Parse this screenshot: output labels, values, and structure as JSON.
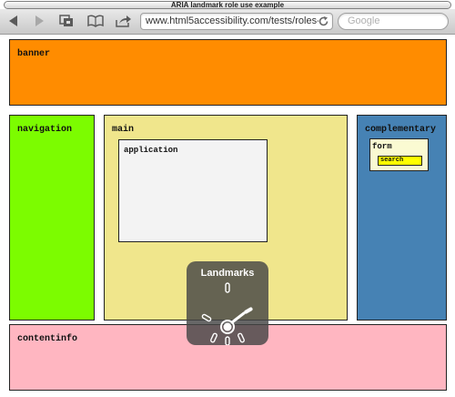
{
  "window": {
    "title": "ARIA landmark role use example"
  },
  "toolbar": {
    "back_icon": "back-arrow-icon",
    "forward_icon": "forward-arrow-icon",
    "tabs_icon": "tabs-icon",
    "bookmarks_icon": "open-book-icon",
    "share_icon": "share-icon",
    "url": "www.html5accessibility.com/tests/roles-la…",
    "reload_icon": "reload-icon",
    "search_placeholder": "Google"
  },
  "landmarks": {
    "banner": {
      "label": "banner",
      "color": "#ff8c00"
    },
    "navigation": {
      "label": "navigation",
      "color": "#7cfc00"
    },
    "main": {
      "label": "main",
      "color": "#f0e68c"
    },
    "application": {
      "label": "application",
      "color": "#f3f3f3"
    },
    "complementary": {
      "label": "complementary",
      "color": "#4682b4"
    },
    "form": {
      "label": "form",
      "color": "#fafad2"
    },
    "search": {
      "label": "search",
      "color": "#ffff00"
    },
    "contentinfo": {
      "label": "contentinfo",
      "color": "#ffb6c1"
    }
  },
  "rotor": {
    "title": "Landmarks",
    "icon": "rotor-dial-icon"
  }
}
